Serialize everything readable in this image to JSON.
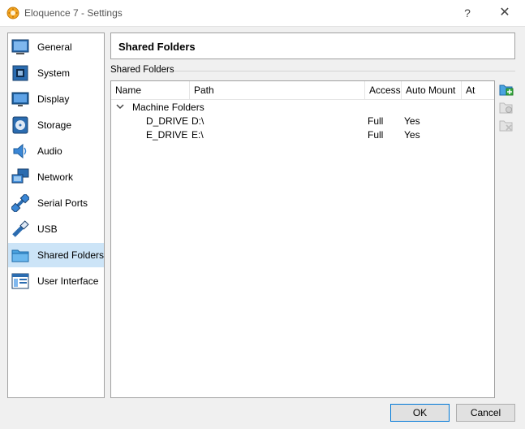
{
  "window": {
    "title": "Eloquence 7 - Settings",
    "help_glyph": "?",
    "close_glyph": "✕"
  },
  "sidebar": {
    "items": [
      {
        "label": "General",
        "icon": "general-icon"
      },
      {
        "label": "System",
        "icon": "system-icon"
      },
      {
        "label": "Display",
        "icon": "display-icon"
      },
      {
        "label": "Storage",
        "icon": "storage-icon"
      },
      {
        "label": "Audio",
        "icon": "audio-icon"
      },
      {
        "label": "Network",
        "icon": "network-icon"
      },
      {
        "label": "Serial Ports",
        "icon": "serial-ports-icon"
      },
      {
        "label": "USB",
        "icon": "usb-icon"
      },
      {
        "label": "Shared Folders",
        "icon": "shared-folders-icon",
        "selected": true
      },
      {
        "label": "User Interface",
        "icon": "user-interface-icon"
      }
    ]
  },
  "main": {
    "title": "Shared Folders",
    "group_label": "Shared Folders",
    "columns": [
      "Name",
      "Path",
      "Access",
      "Auto Mount",
      "At"
    ],
    "group_node": "Machine Folders",
    "rows": [
      {
        "name": "D_DRIVE",
        "path": "D:\\",
        "access": "Full",
        "auto_mount": "Yes",
        "at": ""
      },
      {
        "name": "E_DRIVE",
        "path": "E:\\",
        "access": "Full",
        "auto_mount": "Yes",
        "at": ""
      }
    ]
  },
  "footer": {
    "ok_label": "OK",
    "cancel_label": "Cancel"
  },
  "colors": {
    "selection": "#cce4f7",
    "accent": "#0078d7",
    "folder": "#4aa3e0"
  }
}
